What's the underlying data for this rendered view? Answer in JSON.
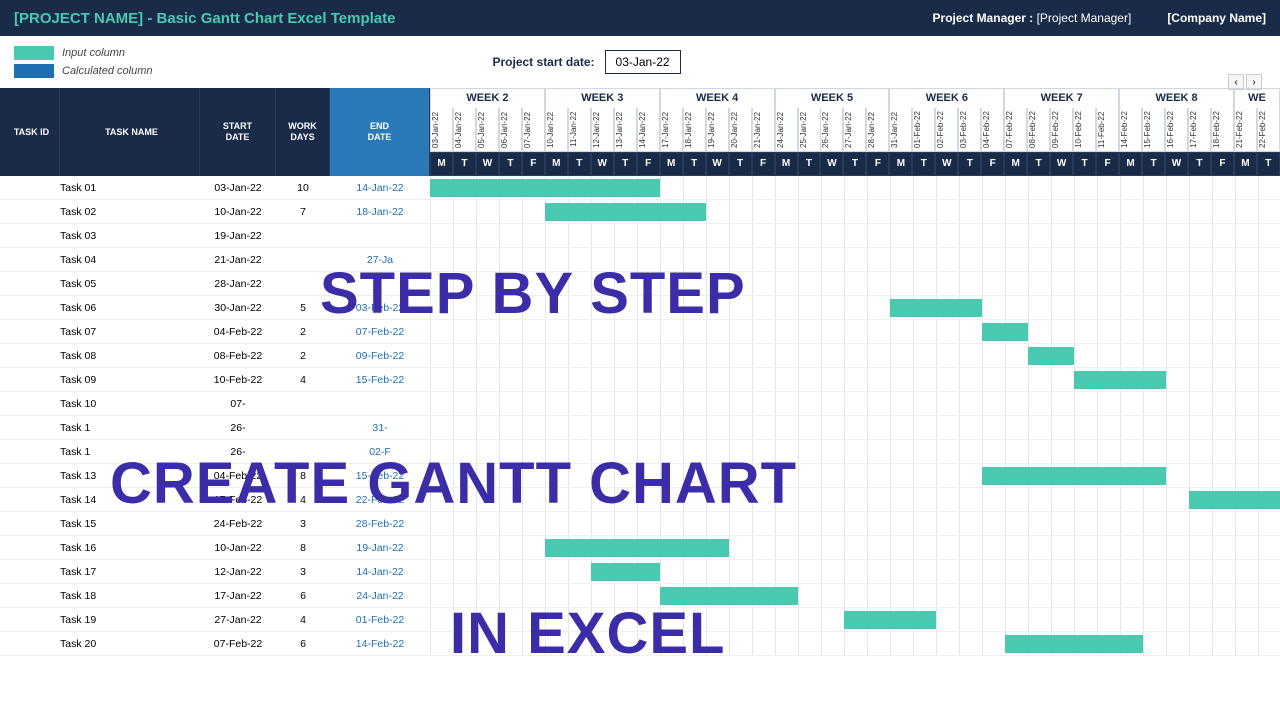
{
  "header": {
    "title": "[PROJECT NAME] - Basic Gantt Chart Excel Template",
    "pm_label": "Project Manager :",
    "pm_value": "[Project Manager]",
    "company": "[Company Name]"
  },
  "legend": {
    "input": "Input column",
    "calculated": "Calculated column"
  },
  "start_date": {
    "label": "Project start date:",
    "value": "03-Jan-22"
  },
  "nav": {
    "prev": "‹",
    "next": "›"
  },
  "columns": {
    "task_id": "TASK ID",
    "task_name": "TASK NAME",
    "start_date": "START\nDATE",
    "work_days": "WORK\nDAYS",
    "end_date": "END\nDATE"
  },
  "overlay": {
    "line1": "STEP BY STEP",
    "line2": "CREATE GANTT CHART",
    "line3": "IN EXCEL"
  },
  "chart_data": {
    "type": "gantt",
    "weeks": [
      "WEEK 2",
      "WEEK 3",
      "WEEK 4",
      "WEEK 5",
      "WEEK 6",
      "WEEK 7",
      "WEEK 8",
      "WE"
    ],
    "dates": [
      "03-Jan-22",
      "04-Jan-22",
      "05-Jan-22",
      "06-Jan-22",
      "07-Jan-22",
      "10-Jan-22",
      "11-Jan-22",
      "12-Jan-22",
      "13-Jan-22",
      "14-Jan-22",
      "17-Jan-22",
      "18-Jan-22",
      "19-Jan-22",
      "20-Jan-22",
      "21-Jan-22",
      "24-Jan-22",
      "25-Jan-22",
      "26-Jan-22",
      "27-Jan-22",
      "28-Jan-22",
      "31-Jan-22",
      "01-Feb-22",
      "02-Feb-22",
      "03-Feb-22",
      "04-Feb-22",
      "07-Feb-22",
      "08-Feb-22",
      "09-Feb-22",
      "10-Feb-22",
      "11-Feb-22",
      "14-Feb-22",
      "15-Feb-22",
      "16-Feb-22",
      "17-Feb-22",
      "18-Feb-22",
      "21-Feb-22",
      "22-Feb-22"
    ],
    "day_letters": [
      "M",
      "T",
      "W",
      "T",
      "F",
      "M",
      "T",
      "W",
      "T",
      "F",
      "M",
      "T",
      "W",
      "T",
      "F",
      "M",
      "T",
      "W",
      "T",
      "F",
      "M",
      "T",
      "W",
      "T",
      "F",
      "M",
      "T",
      "W",
      "T",
      "F",
      "M",
      "T",
      "W",
      "T",
      "F",
      "M",
      "T"
    ],
    "tasks": [
      {
        "id": "",
        "name": "Task 01",
        "start": "03-Jan-22",
        "days": 10,
        "end": "14-Jan-22",
        "bar_start": 0,
        "bar_len": 10
      },
      {
        "id": "",
        "name": "Task 02",
        "start": "10-Jan-22",
        "days": 7,
        "end": "18-Jan-22",
        "bar_start": 5,
        "bar_len": 7
      },
      {
        "id": "",
        "name": "Task 03",
        "start": "19-Jan-22",
        "days": null,
        "end": "",
        "bar_start": null,
        "bar_len": null
      },
      {
        "id": "",
        "name": "Task 04",
        "start": "21-Jan-22",
        "days": null,
        "end": "27-Ja",
        "bar_start": null,
        "bar_len": null
      },
      {
        "id": "",
        "name": "Task 05",
        "start": "28-Jan-22",
        "days": null,
        "end": "",
        "bar_start": null,
        "bar_len": null
      },
      {
        "id": "",
        "name": "Task 06",
        "start": "30-Jan-22",
        "days": 5,
        "end": "03-Feb-22",
        "bar_start": 20,
        "bar_len": 4
      },
      {
        "id": "",
        "name": "Task 07",
        "start": "04-Feb-22",
        "days": 2,
        "end": "07-Feb-22",
        "bar_start": 24,
        "bar_len": 2
      },
      {
        "id": "",
        "name": "Task 08",
        "start": "08-Feb-22",
        "days": 2,
        "end": "09-Feb-22",
        "bar_start": 26,
        "bar_len": 2
      },
      {
        "id": "",
        "name": "Task 09",
        "start": "10-Feb-22",
        "days": 4,
        "end": "15-Feb-22",
        "bar_start": 28,
        "bar_len": 4
      },
      {
        "id": "",
        "name": "Task 10",
        "start": "07-",
        "days": null,
        "end": "",
        "bar_start": null,
        "bar_len": null
      },
      {
        "id": "",
        "name": "Task 1",
        "start": "26-",
        "days": null,
        "end": "31-",
        "bar_start": null,
        "bar_len": null
      },
      {
        "id": "",
        "name": "Task 1",
        "start": "26-",
        "days": null,
        "end": "02-F",
        "bar_start": null,
        "bar_len": null
      },
      {
        "id": "",
        "name": "Task 13",
        "start": "04-Feb-22",
        "days": 8,
        "end": "15-Feb-22",
        "bar_start": 24,
        "bar_len": 8
      },
      {
        "id": "",
        "name": "Task 14",
        "start": "17-Feb-22",
        "days": 4,
        "end": "22-Feb-22",
        "bar_start": 33,
        "bar_len": 4
      },
      {
        "id": "",
        "name": "Task 15",
        "start": "24-Feb-22",
        "days": 3,
        "end": "28-Feb-22",
        "bar_start": null,
        "bar_len": null
      },
      {
        "id": "",
        "name": "Task 16",
        "start": "10-Jan-22",
        "days": 8,
        "end": "19-Jan-22",
        "bar_start": 5,
        "bar_len": 8
      },
      {
        "id": "",
        "name": "Task 17",
        "start": "12-Jan-22",
        "days": 3,
        "end": "14-Jan-22",
        "bar_start": 7,
        "bar_len": 3
      },
      {
        "id": "",
        "name": "Task 18",
        "start": "17-Jan-22",
        "days": 6,
        "end": "24-Jan-22",
        "bar_start": 10,
        "bar_len": 6
      },
      {
        "id": "",
        "name": "Task 19",
        "start": "27-Jan-22",
        "days": 4,
        "end": "01-Feb-22",
        "bar_start": 18,
        "bar_len": 4
      },
      {
        "id": "",
        "name": "Task 20",
        "start": "07-Feb-22",
        "days": 6,
        "end": "14-Feb-22",
        "bar_start": 25,
        "bar_len": 6
      }
    ]
  }
}
